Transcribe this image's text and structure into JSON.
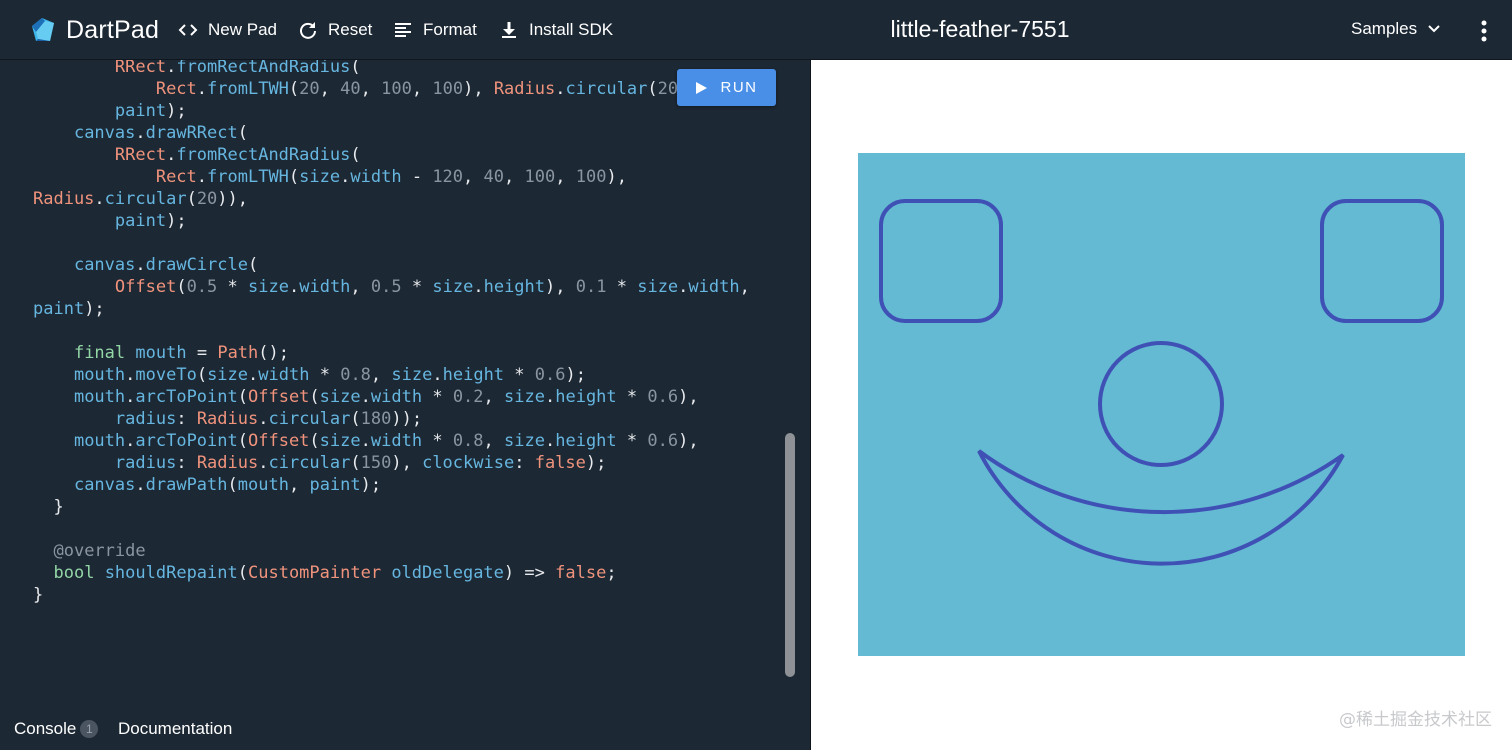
{
  "app": {
    "name": "DartPad",
    "pad_title": "little-feather-7551"
  },
  "toolbar": {
    "new_pad_label": "New Pad",
    "reset_label": "Reset",
    "format_label": "Format",
    "install_sdk_label": "Install SDK",
    "samples_label": "Samples"
  },
  "editor": {
    "run_label": "RUN",
    "code_lines": [
      "        RRect.fromRectAndRadius(",
      "            Rect.fromLTWH(20, 40, 100, 100), Radius.circular(20)),",
      "        paint);",
      "    canvas.drawRRect(",
      "        RRect.fromRectAndRadius(",
      "            Rect.fromLTWH(size.width - 120, 40, 100, 100),",
      "Radius.circular(20)),",
      "        paint);",
      "",
      "    canvas.drawCircle(",
      "        Offset(0.5 * size.width, 0.5 * size.height), 0.1 * size.width,",
      "paint);",
      "",
      "    final mouth = Path();",
      "    mouth.moveTo(size.width * 0.8, size.height * 0.6);",
      "    mouth.arcToPoint(Offset(size.width * 0.2, size.height * 0.6),",
      "        radius: Radius.circular(180));",
      "    mouth.arcToPoint(Offset(size.width * 0.8, size.height * 0.6),",
      "        radius: Radius.circular(150), clockwise: false);",
      "    canvas.drawPath(mouth, paint);",
      "  }",
      "",
      "  @override",
      "  bool shouldRepaint(CustomPainter oldDelegate) => false;",
      "}"
    ]
  },
  "bottom": {
    "console_label": "Console",
    "console_count": "1",
    "documentation_label": "Documentation"
  },
  "output": {
    "background_color": "#64b9d3",
    "stroke_color": "#3f51b5",
    "watermark": "@稀土掘金技术社区"
  },
  "colors": {
    "topbar": "#1c2834",
    "run_button": "#4a8fe7"
  },
  "icons": [
    "dart-logo-icon",
    "code-brackets-icon",
    "refresh-icon",
    "format-lines-icon",
    "download-icon",
    "chevron-down-icon",
    "more-vert-icon",
    "play-icon"
  ]
}
